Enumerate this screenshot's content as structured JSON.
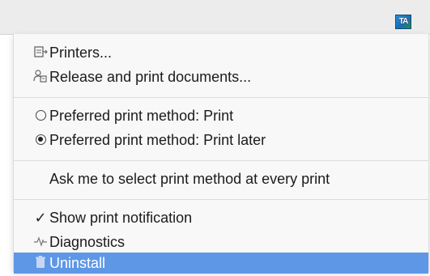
{
  "tray": {
    "icon_text": "TA",
    "icon_name": "print-agent-tray-icon"
  },
  "menu": {
    "items": [
      {
        "label": "Printers...",
        "icon": "printer-icon"
      },
      {
        "label": "Release and print documents...",
        "icon": "release-print-icon"
      },
      {
        "label": "Preferred print method: Print",
        "radio": false
      },
      {
        "label": "Preferred print method: Print later",
        "radio": true
      },
      {
        "label": "Ask me to select print method at every print"
      },
      {
        "label": "Show print notification",
        "checked": true,
        "check_glyph": "✓"
      },
      {
        "label": "Diagnostics",
        "icon": "diagnostics-icon",
        "icon_glyph": "⏦"
      },
      {
        "label": "Uninstall",
        "icon": "trash-icon",
        "selected": true
      }
    ]
  },
  "colors": {
    "highlight": "#5e97e6",
    "menu_bg": "#f8f8f8"
  }
}
